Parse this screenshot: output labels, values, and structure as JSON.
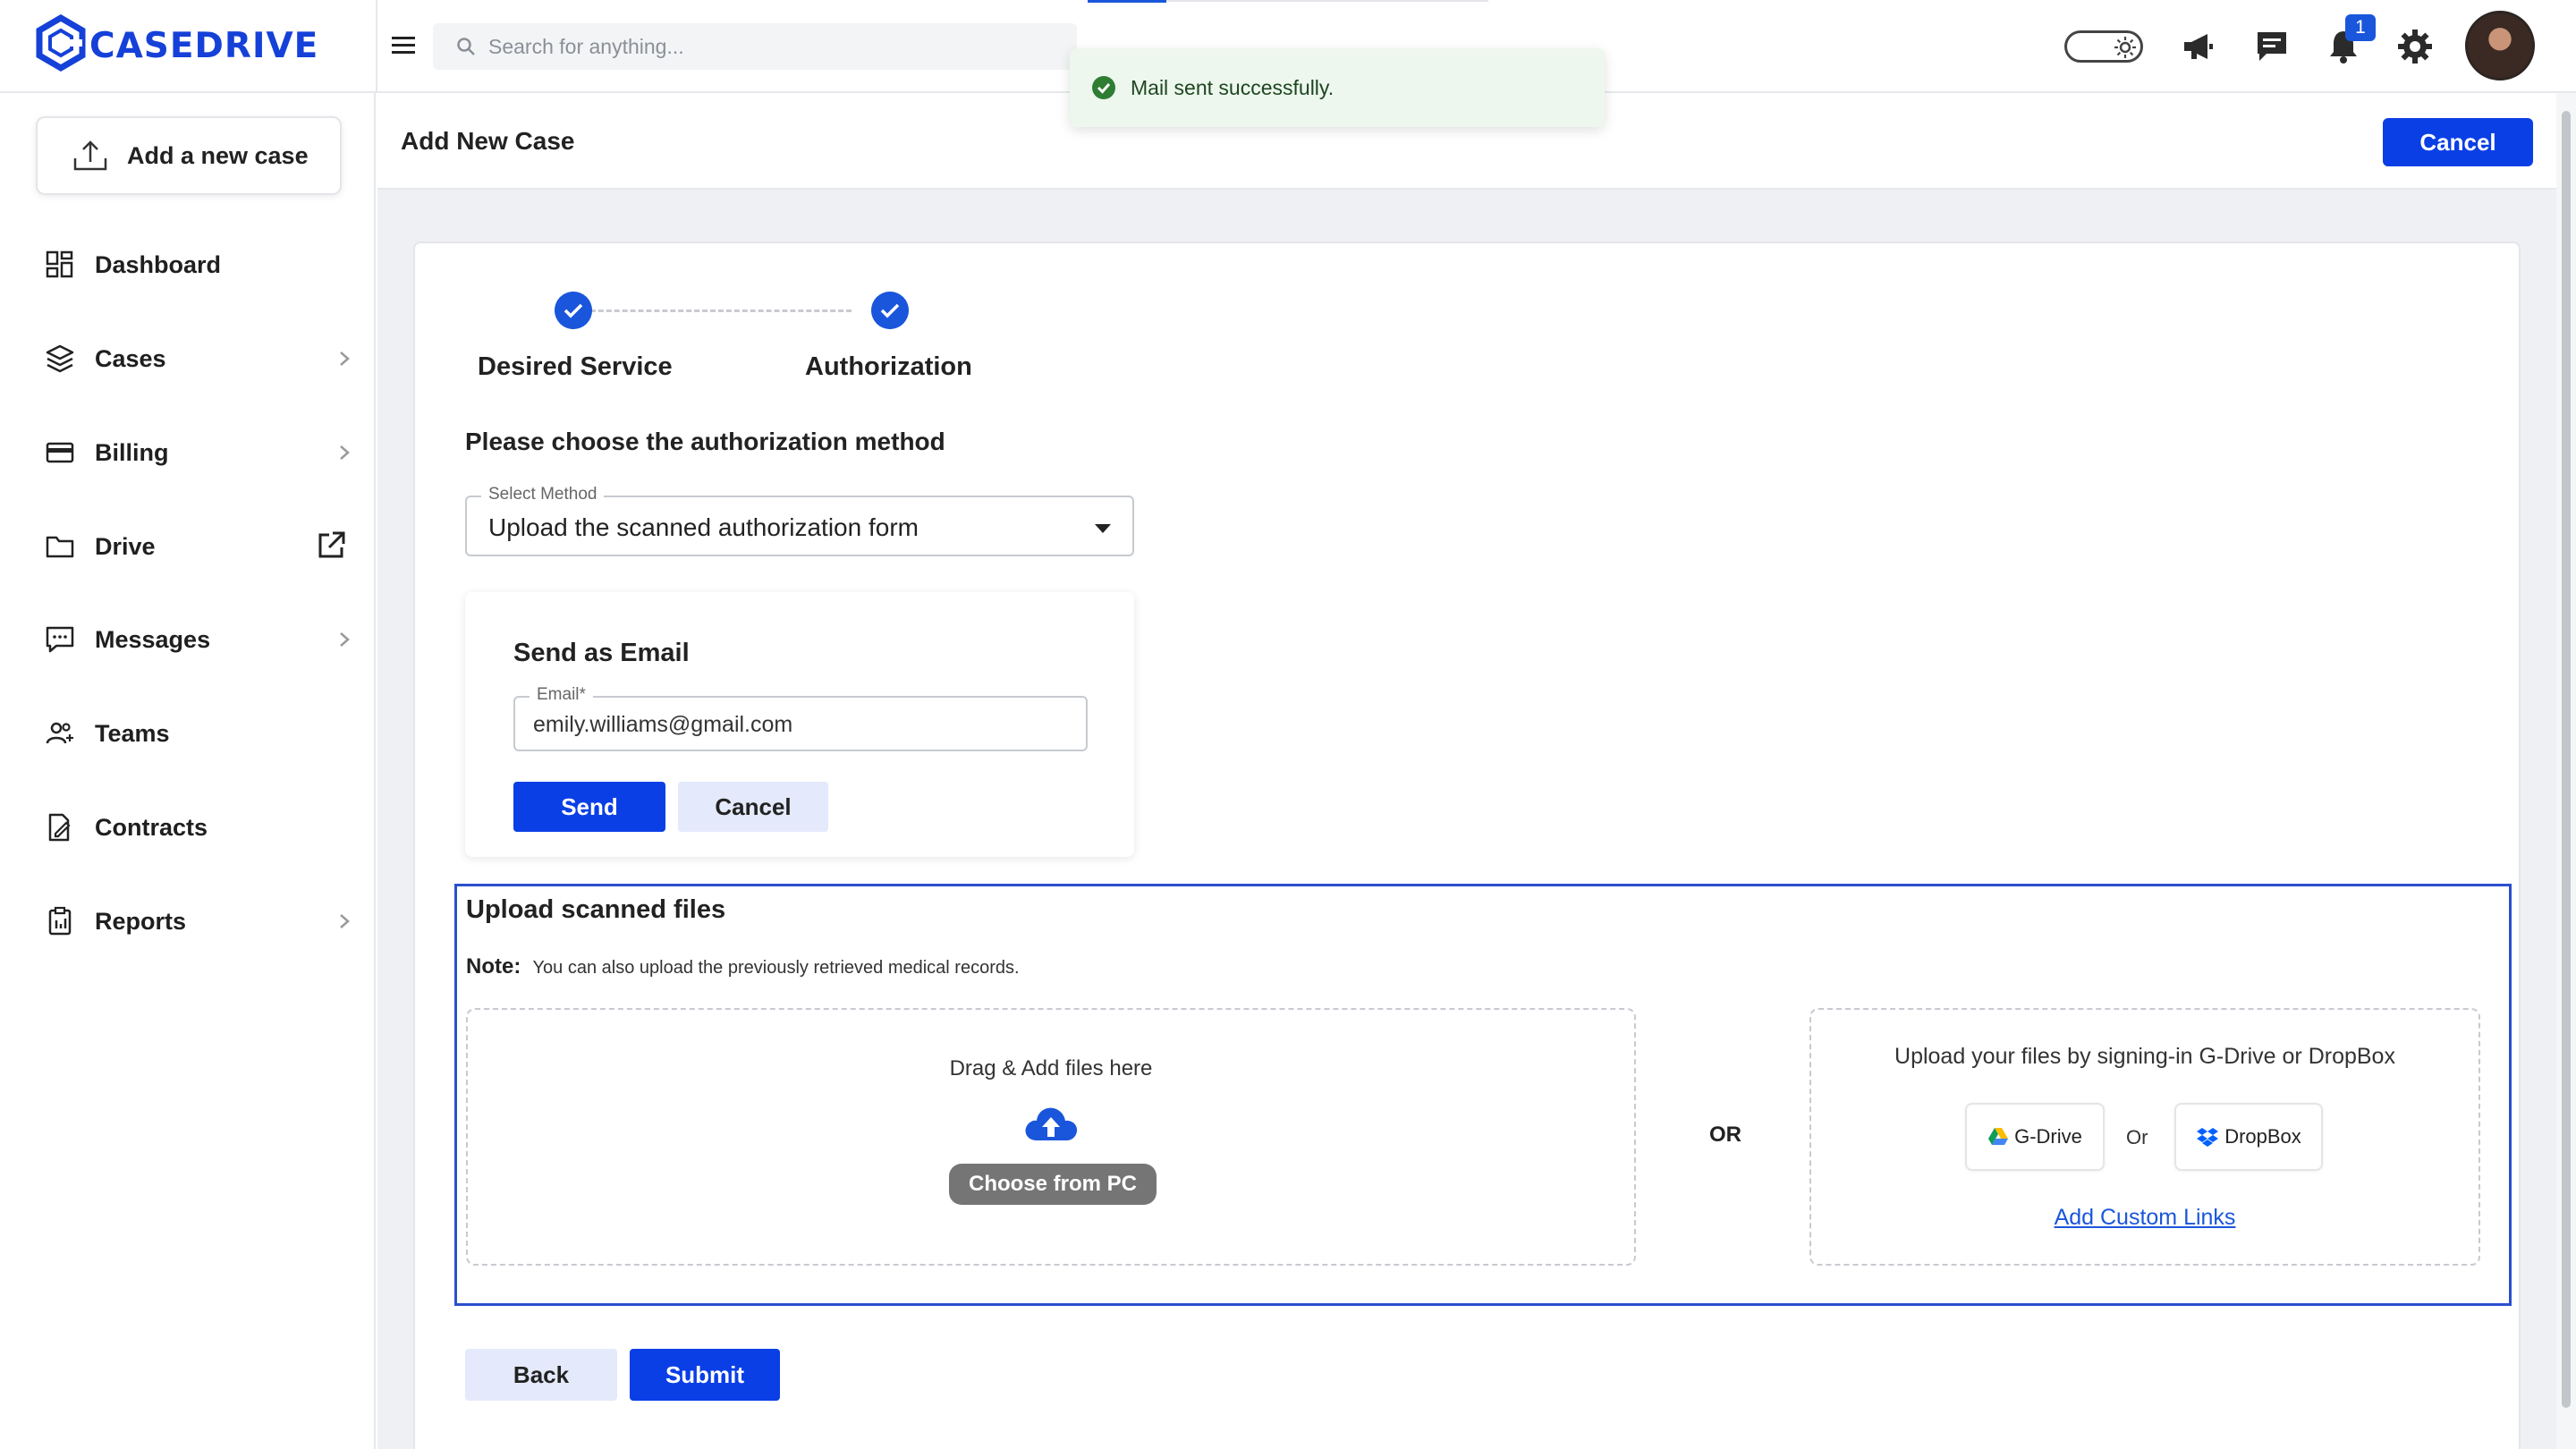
{
  "brand": {
    "name": "CASEDRIVE",
    "color": "#1541d8"
  },
  "search": {
    "placeholder": "Search for anything..."
  },
  "toast": {
    "message": "Mail sent successfully.",
    "type": "success"
  },
  "topbar": {
    "icons": [
      "theme-toggle-icon",
      "megaphone-icon",
      "chat-icon",
      "bell-icon",
      "gear-icon"
    ],
    "notifications_count": "1"
  },
  "sidebar": {
    "add_case_label": "Add a new case",
    "items": [
      {
        "label": "Dashboard",
        "icon": "dashboard-icon",
        "has_submenu": false
      },
      {
        "label": "Cases",
        "icon": "layers-icon",
        "has_submenu": true
      },
      {
        "label": "Billing",
        "icon": "credit-card-icon",
        "has_submenu": true
      },
      {
        "label": "Drive",
        "icon": "folder-icon",
        "external": true
      },
      {
        "label": "Messages",
        "icon": "message-icon",
        "has_submenu": true
      },
      {
        "label": "Teams",
        "icon": "users-icon",
        "has_submenu": false
      },
      {
        "label": "Contracts",
        "icon": "contract-icon",
        "has_submenu": false
      },
      {
        "label": "Reports",
        "icon": "clipboard-icon",
        "has_submenu": true
      }
    ]
  },
  "header": {
    "title": "Add New Case",
    "cancel_label": "Cancel"
  },
  "steps": [
    {
      "label": "Desired Service",
      "completed": true
    },
    {
      "label": "Authorization",
      "completed": true
    }
  ],
  "authorization": {
    "question": "Please choose the authorization method",
    "select_label": "Select Method",
    "select_value": "Upload the scanned authorization form"
  },
  "email_panel": {
    "title": "Send as Email",
    "field_label": "Email*",
    "email_value": "emily.williams@gmail.com",
    "send_label": "Send",
    "cancel_label": "Cancel"
  },
  "upload": {
    "title": "Upload scanned files",
    "note_label": "Note:",
    "note_text": "You can also upload the previously retrieved medical records.",
    "drag_text": "Drag & Add files here",
    "choose_label": "Choose from PC",
    "or_label": "OR",
    "cloud_text": "Upload your files by signing-in G-Drive or DropBox",
    "gdrive_label": "G-Drive",
    "or_small": "Or",
    "dropbox_label": "DropBox",
    "custom_links_label": "Add Custom Links"
  },
  "footer": {
    "back_label": "Back",
    "submit_label": "Submit"
  },
  "colors": {
    "primary": "#0a3fe6",
    "accent": "#1a56db",
    "success": "#2e7d32",
    "upload_border": "#2b4fcf"
  }
}
